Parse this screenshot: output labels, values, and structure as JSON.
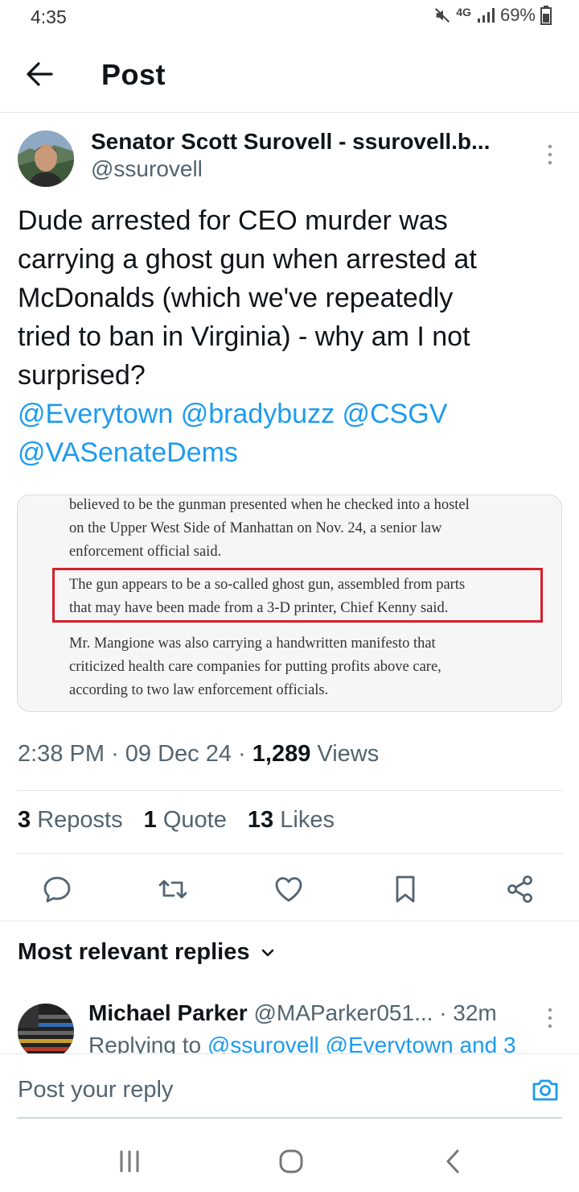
{
  "status": {
    "time": "4:35",
    "network": "4G",
    "battery": "69%"
  },
  "header": {
    "title": "Post"
  },
  "post": {
    "author_name": "Senator Scott Surovell - ssurovell.b...",
    "author_handle": "@ssurovell",
    "text_lines": [
      "Dude arrested for CEO murder was",
      "carrying a ghost gun when arrested at",
      "McDonalds (which we've repeatedly",
      "tried to ban in Virginia) - why am I not",
      "surprised?"
    ],
    "mentions_line1": "@Everytown @bradybuzz @CSGV",
    "mentions_line2": "@VASenateDems",
    "article": {
      "para1": [
        "believed to be the gunman presented when he checked into a hostel",
        "on the Upper West Side of Manhattan on Nov. 24, a senior law",
        "enforcement official said."
      ],
      "para2": [
        "The gun appears to be a so-called ghost gun, assembled from parts",
        "that may have been made from a 3-D printer, Chief Kenny said."
      ],
      "para3": [
        "Mr. Mangione was also carrying a handwritten manifesto that",
        "criticized health care companies for putting profits above care,",
        "according to two law enforcement officials."
      ]
    },
    "time": "2:38 PM",
    "date": "09 Dec 24",
    "views_count": "1,289",
    "views_label": "Views",
    "reposts_count": "3",
    "reposts_label": "Reposts",
    "quotes_count": "1",
    "quotes_label": "Quote",
    "likes_count": "13",
    "likes_label": "Likes"
  },
  "replies": {
    "header": "Most relevant replies",
    "items": [
      {
        "name": "Michael Parker",
        "handle": "@MAParker051...",
        "time": "· 32m",
        "replying_prefix": "Replying to",
        "replying_to": "@ssurovell @Everytown and 3"
      }
    ]
  },
  "compose": {
    "placeholder": "Post your reply"
  },
  "colors": {
    "accent": "#1d9bf0",
    "highlight": "#d4202b"
  }
}
